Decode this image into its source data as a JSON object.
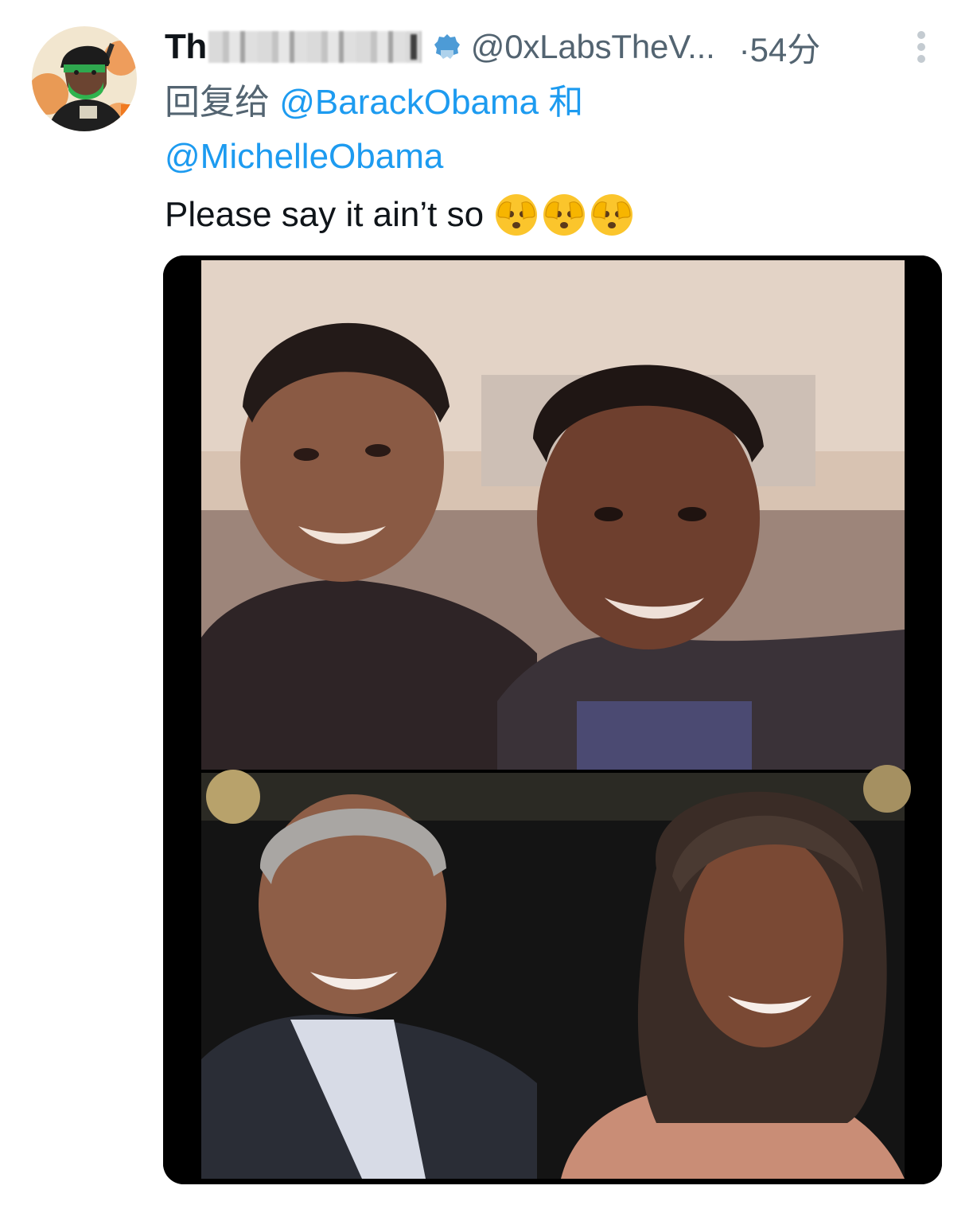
{
  "tweet": {
    "display_name_prefix": "Th",
    "handle": "@0xLabsTheV...",
    "time": "·54分",
    "reply_prefix": "回复给",
    "reply_mention_1": "@BarackObama",
    "reply_joiner": "和",
    "reply_mention_2": "@MichelleObama",
    "text": "Please say it ain’t so"
  },
  "icons": {
    "avatar": "avatar-icon",
    "verified": "verified-badge-icon",
    "more": "more-options-icon",
    "emoji": "face-with-open-eyes-and-hand-over-mouth-icon"
  },
  "colors": {
    "link": "#1d9bf0",
    "secondary": "#536471",
    "text": "#0f1419",
    "media_bg": "#000000"
  }
}
